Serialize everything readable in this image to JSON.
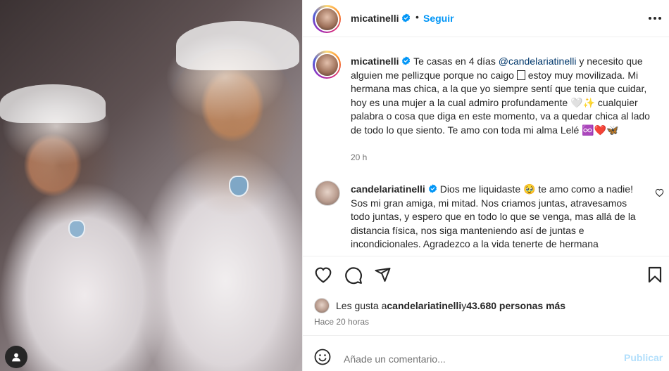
{
  "post": {
    "author": "micatinelli",
    "follow_label": "Seguir",
    "dot": "•",
    "caption": {
      "author": "micatinelli",
      "text_1": " Te casas en 4 días ",
      "mention": "@candelariatinelli",
      "text_2": " y necesito que alguien me pellizque porque no caigo ",
      "text_3": " estoy muy movilizada. Mi hermana mas chica, a la que yo siempre sentí que tenia que cuidar, hoy es una mujer a la cual admiro profundamente ",
      "emoji_1": "🤍✨",
      "text_4": " cualquier palabra o cosa que diga en este momento, va a quedar chica al lado de todo lo que siento. Te amo con toda mi alma Lelé ",
      "emoji_2": "♾️❤️🦋",
      "time": "20 h"
    },
    "comment": {
      "author": "candelariatinelli",
      "text_1": " Dios me liquidaste ",
      "emoji": "🥹",
      "text_2": " te amo como a nadie! Sos mi gran amiga, mi mitad. Nos criamos juntas, atravesamos todo juntas, y espero que en todo lo que se venga, mas allá de la distancia física, nos siga manteniendo así de juntas e incondicionales. Agradezco a la vida tenerte de hermana"
    },
    "likes": {
      "prefix": "Les gusta a ",
      "user": "candelariatinelli",
      "middle": " y ",
      "count": "43.680 personas más"
    },
    "time_ago": "Hace 20 horas",
    "comment_input": {
      "placeholder": "Añade un comentario..."
    },
    "publish_label": "Publicar"
  },
  "icons": {
    "verified": "verified-badge-icon",
    "more": "more-options-icon",
    "like": "heart-icon",
    "comment": "comment-icon",
    "share": "share-icon",
    "save": "bookmark-icon",
    "emoji": "emoji-icon",
    "user": "user-icon"
  },
  "colors": {
    "link": "#0095f6",
    "mention": "#00376b",
    "verified": "#0095f6",
    "publish_disabled": "#b2dffc",
    "muted": "#737373"
  }
}
